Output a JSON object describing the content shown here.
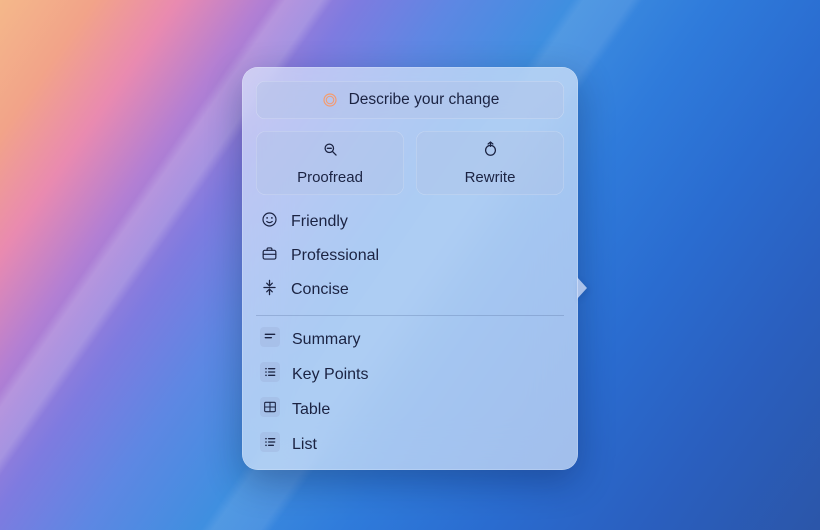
{
  "prompt": {
    "placeholder": "Describe your change"
  },
  "primary": {
    "proofread": "Proofread",
    "rewrite": "Rewrite"
  },
  "tones": {
    "friendly": "Friendly",
    "professional": "Professional",
    "concise": "Concise"
  },
  "formats": {
    "summary": "Summary",
    "keypoints": "Key Points",
    "table": "Table",
    "list": "List"
  }
}
